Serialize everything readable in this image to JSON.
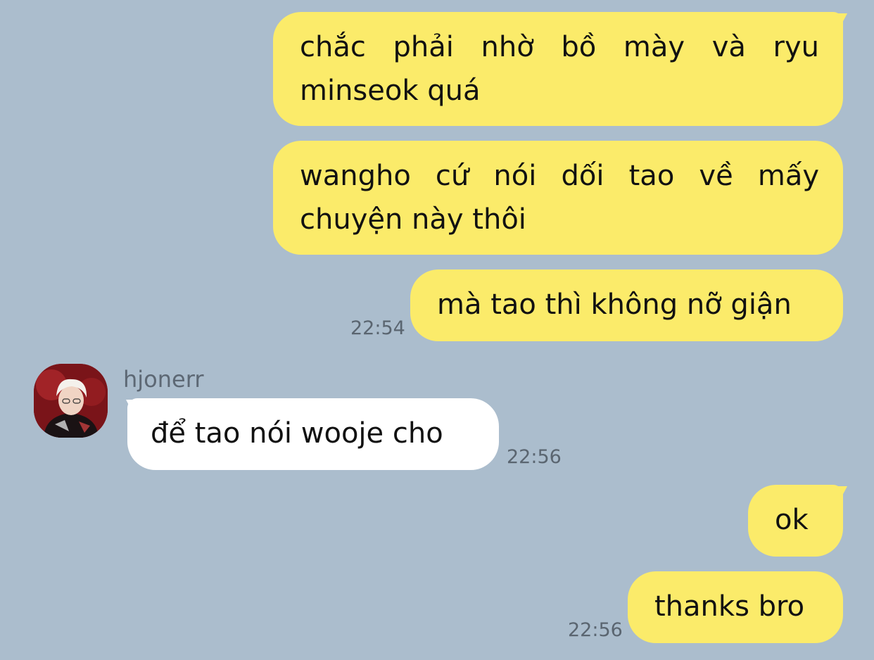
{
  "conversation": {
    "messages": [
      {
        "text": "chắc phải nhờ bồ mày và ryu minseok quá",
        "direction": "outgoing"
      },
      {
        "text": "wangho cứ nói dối tao về mấy chuyện này thôi",
        "direction": "outgoing"
      },
      {
        "text": "mà tao thì không nỡ giận",
        "direction": "outgoing",
        "time": "22:54"
      },
      {
        "text": "để tao nói wooje cho",
        "direction": "incoming",
        "sender": "hjonerr",
        "time": "22:56"
      },
      {
        "text": "ok",
        "direction": "outgoing"
      },
      {
        "text": "thanks bro",
        "direction": "outgoing",
        "time": "22:56"
      }
    ]
  },
  "colors": {
    "background": "#abbdcd",
    "outgoing_bubble": "#fbeb6a",
    "incoming_bubble": "#ffffff",
    "timestamp": "#5a6570",
    "sender_name": "#5d6874"
  },
  "icons": {
    "avatar": "profile-photo"
  }
}
